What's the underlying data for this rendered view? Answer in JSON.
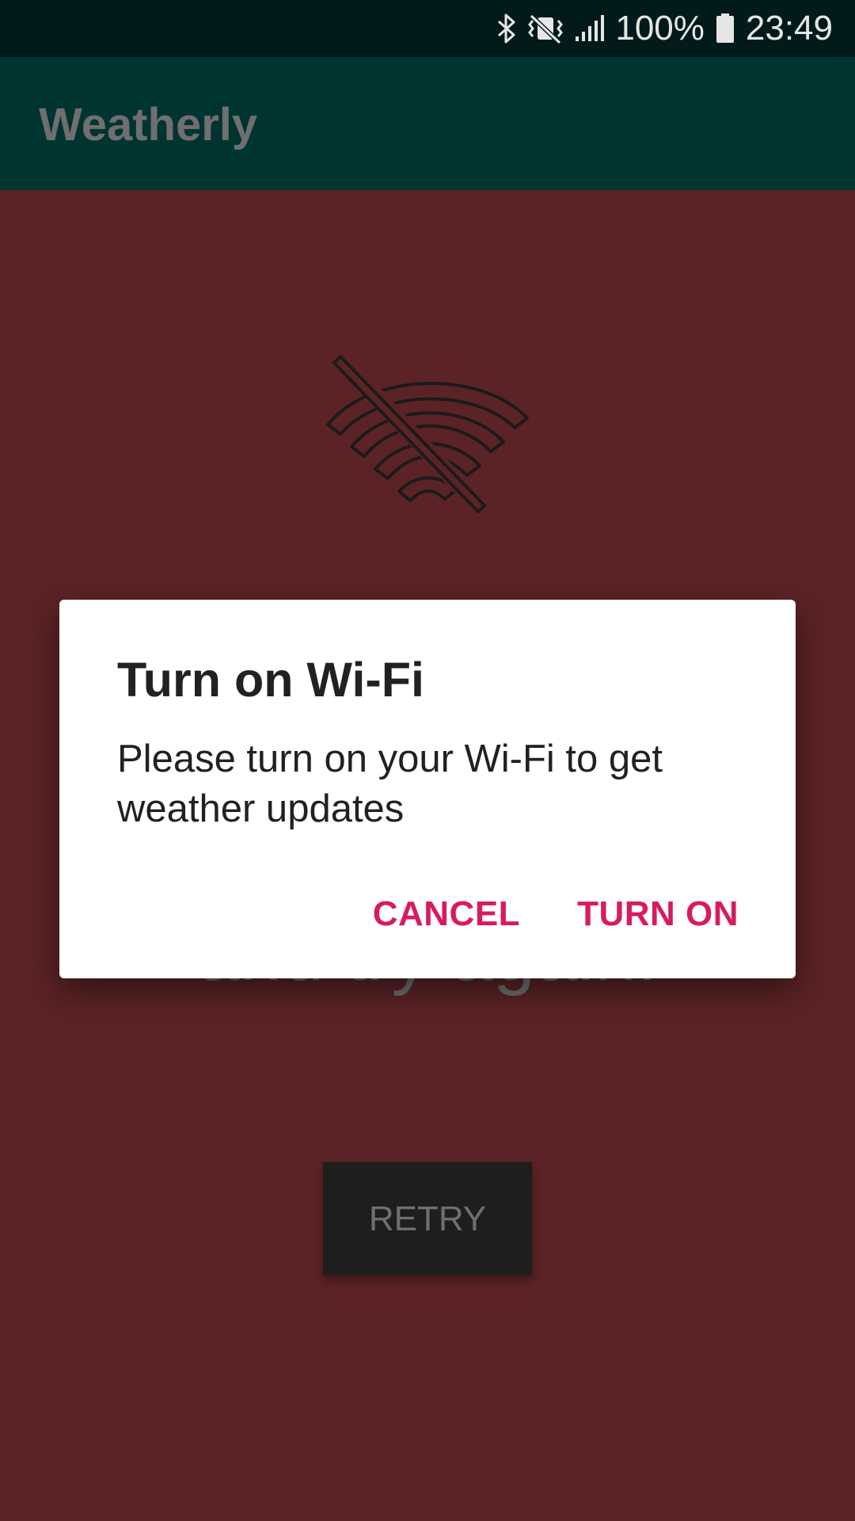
{
  "status_bar": {
    "battery_percent": "100%",
    "time": "23:49",
    "icons": [
      "bluetooth-icon",
      "vibrate-icon",
      "signal-icon",
      "battery-icon"
    ]
  },
  "app_bar": {
    "title": "Weatherly"
  },
  "background": {
    "icon": "wifi-off-icon",
    "message": "and try again.",
    "retry_label": "RETRY"
  },
  "dialog": {
    "title": "Turn on Wi-Fi",
    "message": "Please turn on your Wi-Fi to get weather updates",
    "cancel_label": "CANCEL",
    "confirm_label": "TURN ON"
  },
  "colors": {
    "background": "#5b2325",
    "app_bar": "#003431",
    "status_bar": "#021b1a",
    "accent": "#d81b60"
  }
}
